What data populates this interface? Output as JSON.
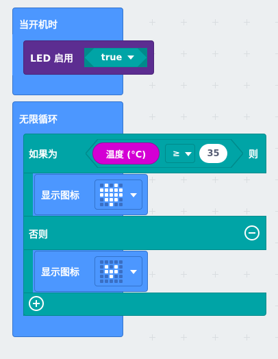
{
  "on_start": {
    "label": "当开机时"
  },
  "led_enable": {
    "label": "LED 启用",
    "value": "true"
  },
  "forever": {
    "label": "无限循环"
  },
  "if_block": {
    "if_label": "如果为",
    "then_label": "则",
    "else_label": "否则",
    "sensor_label": "温度 (°C)",
    "operator": "≥",
    "number": "35"
  },
  "show_icon_1": {
    "label": "显示图标",
    "icon": "heart"
  },
  "show_icon_2": {
    "label": "显示图标",
    "icon": "small-heart"
  },
  "colors": {
    "workspace": "#eceff1",
    "basic_blue": "#4c97ff",
    "led_purple": "#5c2d91",
    "logic_teal": "#00a4a6",
    "sensor_magenta": "#d400d4"
  }
}
